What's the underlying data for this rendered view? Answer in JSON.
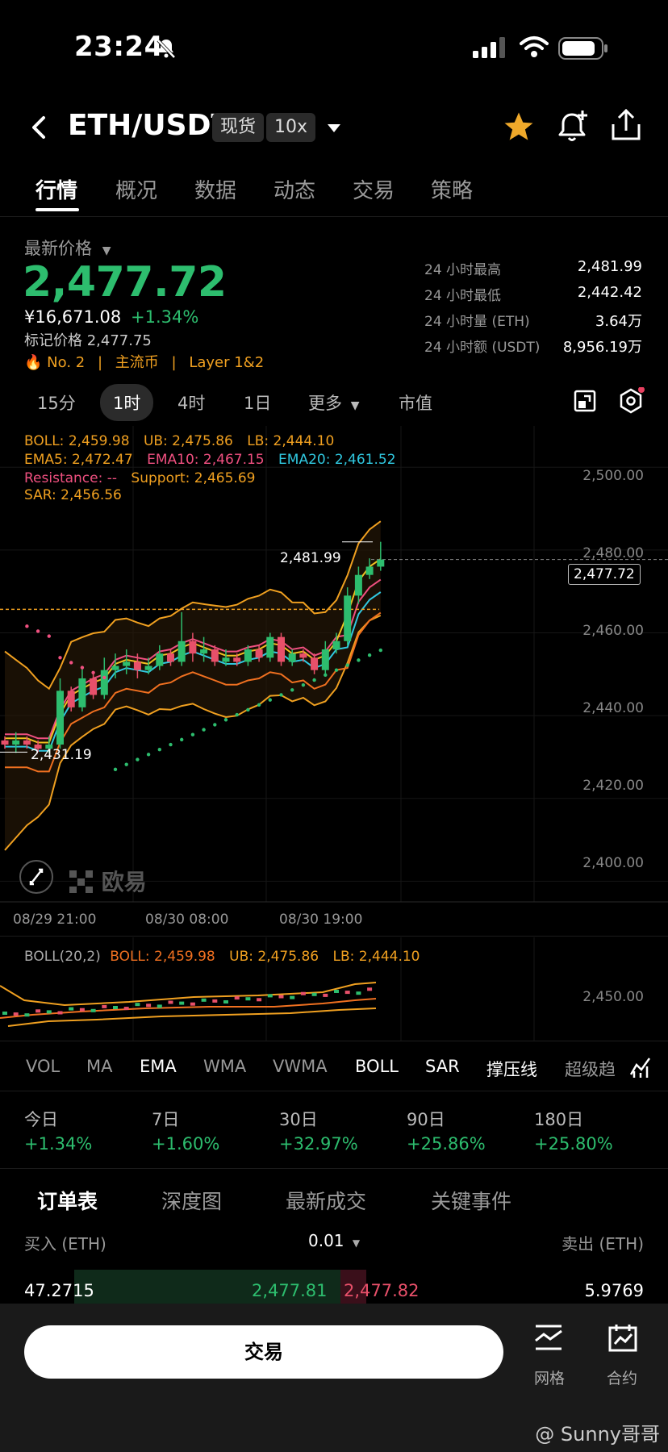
{
  "status": {
    "time": "23:24"
  },
  "header": {
    "pair": "ETH/USDT",
    "tag_spot": "现货",
    "tag_leverage": "10x"
  },
  "tabs": [
    "行情",
    "概况",
    "数据",
    "动态",
    "交易",
    "策略"
  ],
  "price": {
    "label": "最新价格",
    "last": "2,477.72",
    "cny": "¥16,671.08",
    "change": "+1.34%",
    "mark": "标记价格 2,477.75",
    "rank": "No. 2",
    "cat1": "主流币",
    "cat2": "Layer 1&2",
    "stats": [
      {
        "k": "24 小时最高",
        "v": "2,481.99"
      },
      {
        "k": "24 小时最低",
        "v": "2,442.42"
      },
      {
        "k": "24 小时量 (ETH)",
        "v": "3.64万"
      },
      {
        "k": "24 小时额 (USDT)",
        "v": "8,956.19万"
      }
    ]
  },
  "intervals": [
    "15分",
    "1时",
    "4时",
    "1日",
    "更多",
    "市值"
  ],
  "indicators": {
    "boll": "BOLL: 2,459.98",
    "ub": "UB: 2,475.86",
    "lb": "LB: 2,444.10",
    "ema5": "EMA5: 2,472.47",
    "ema10": "EMA10: 2,467.15",
    "ema20": "EMA20: 2,461.52",
    "resistance": "Resistance: --",
    "support": "Support: 2,465.69",
    "sar": "SAR: 2,456.56"
  },
  "chart_data": {
    "type": "candlestick",
    "y_ticks": [
      "2,500.00",
      "2,480.00",
      "2,460.00",
      "2,440.00",
      "2,420.00",
      "2,400.00"
    ],
    "x_ticks": [
      "08/29 21:00",
      "08/30 08:00",
      "08/30 19:00"
    ],
    "high_label": "2,481.99",
    "low_label": "2,431.19",
    "last_label": "2,477.72",
    "ylim": [
      2395,
      2510
    ]
  },
  "sub": {
    "title": "BOLL(20,2)",
    "boll": "BOLL: 2,459.98",
    "ub": "UB: 2,475.86",
    "lb": "LB: 2,444.10",
    "tick": "2,450.00"
  },
  "ind_tabs": [
    "VOL",
    "MA",
    "EMA",
    "WMA",
    "VWMA",
    "BOLL",
    "SAR",
    "撑压线",
    "超级趋"
  ],
  "perf": [
    {
      "k": "今日",
      "v": "+1.34%"
    },
    {
      "k": "7日",
      "v": "+1.60%"
    },
    {
      "k": "30日",
      "v": "+32.97%"
    },
    {
      "k": "90日",
      "v": "+25.86%"
    },
    {
      "k": "180日",
      "v": "+25.80%"
    }
  ],
  "ob_tabs": [
    "订单表",
    "深度图",
    "最新成交",
    "关键事件"
  ],
  "ob": {
    "buy_h": "买入 (ETH)",
    "step": "0.01",
    "sell_h": "卖出 (ETH)",
    "bid_qty": "47.2715",
    "bid": "2,477.81",
    "ask": "2,477.82",
    "ask_qty": "5.9769"
  },
  "footer": {
    "trade": "交易",
    "grid": "网格",
    "contract": "合约",
    "watermark": "@ Sunny哥哥",
    "brand": "欧易"
  }
}
